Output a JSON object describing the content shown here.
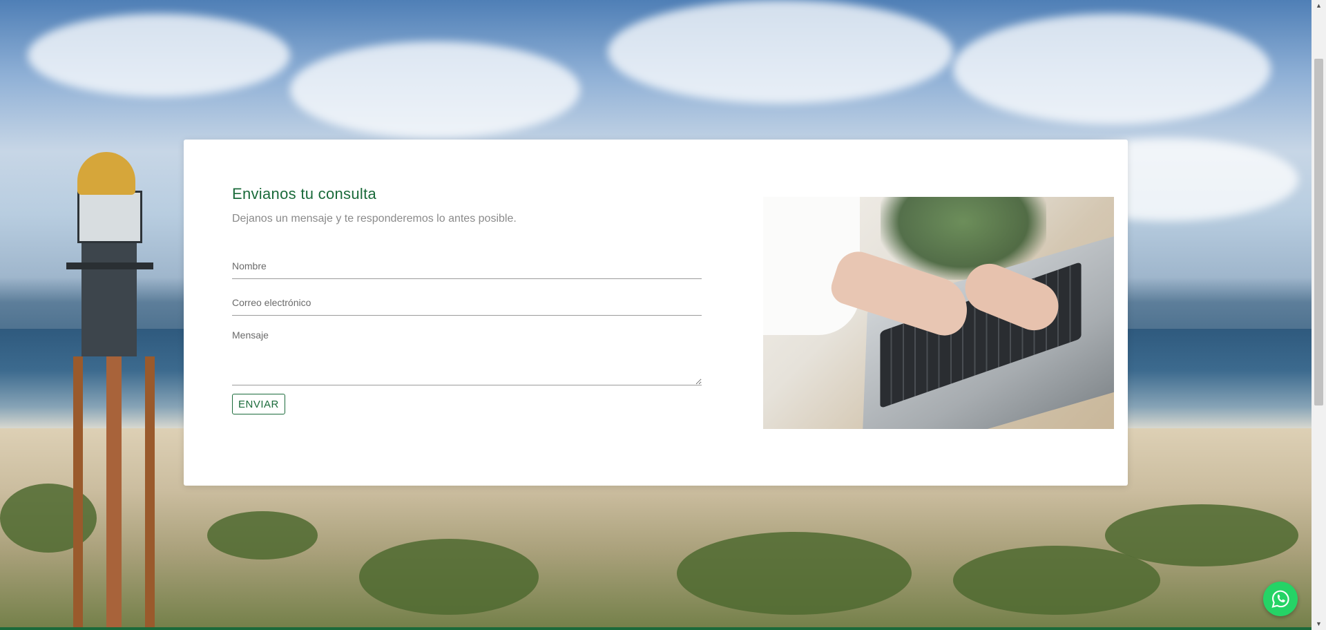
{
  "contact": {
    "title": "Envianos tu consulta",
    "subtitle": "Dejanos un mensaje y te responderemos lo antes posible.",
    "fields": {
      "name_placeholder": "Nombre",
      "email_placeholder": "Correo electrónico",
      "message_placeholder": "Mensaje"
    },
    "submit_label": "ENVIAR",
    "photo_icon": "laptop-typing-photo"
  },
  "colors": {
    "accent": "#1a6a3a",
    "whatsapp": "#25d366"
  },
  "floating": {
    "whatsapp_icon": "whatsapp-icon"
  },
  "background_image": "lighthouse-beach-dunes"
}
